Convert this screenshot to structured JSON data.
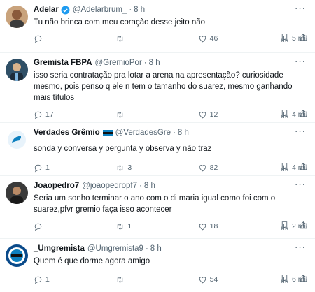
{
  "tweets": [
    {
      "name": "Adelar",
      "handle": "@Adelarbrum_",
      "dot": "·",
      "time": "8 h",
      "verified": true,
      "text": "Tu não brinca com meu coração desse jeito não",
      "replies": "",
      "retweets": "",
      "likes": "46",
      "views": "5 mil"
    },
    {
      "name": "Gremista FBPA",
      "handle": "@GremioPor",
      "dot": "·",
      "time": "8 h",
      "verified": false,
      "text": "isso seria contratação pra lotar a arena na apresentação? curiosidade\nmesmo, pois penso q ele n tem o tamanho do suarez, mesmo ganhando\nmais títulos",
      "replies": "17",
      "retweets": "",
      "likes": "12",
      "views": "4 mil"
    },
    {
      "name": "Verdades Grêmio",
      "handle": "@VerdadesGre",
      "dot": "·",
      "time": "8 h",
      "verified": false,
      "text": "sonda y conversa y pergunta y observa y não traz",
      "replies": "1",
      "retweets": "3",
      "likes": "82",
      "views": "4 mil"
    },
    {
      "name": "Joaopedro7",
      "handle": "@joaopedropf7",
      "dot": "·",
      "time": "8 h",
      "verified": false,
      "text": "Seria um sonho terminar o ano com o di maria igual como foi com o\nsuarez,pfvr gremio faça isso acontecer",
      "replies": "",
      "retweets": "1",
      "likes": "18",
      "views": "2 mil"
    },
    {
      "name": "_Umgremista",
      "handle": "@Umgremista9",
      "dot": "·",
      "time": "8 h",
      "verified": false,
      "text": "Quem é que dorme agora amigo",
      "replies": "1",
      "retweets": "",
      "likes": "54",
      "views": "6 mil"
    }
  ],
  "icons": {
    "reply": "reply-icon",
    "retweet": "retweet-icon",
    "like": "like-icon",
    "views": "views-icon",
    "bookmark": "bookmark-icon",
    "share": "share-icon",
    "more": "more-icon",
    "verified": "verified-badge-icon",
    "flag": "flag-icon"
  },
  "colors": {
    "text": "#0f1419",
    "secondary": "#536471",
    "verified": "#1d9bf0",
    "divider": "#eff3f4"
  }
}
